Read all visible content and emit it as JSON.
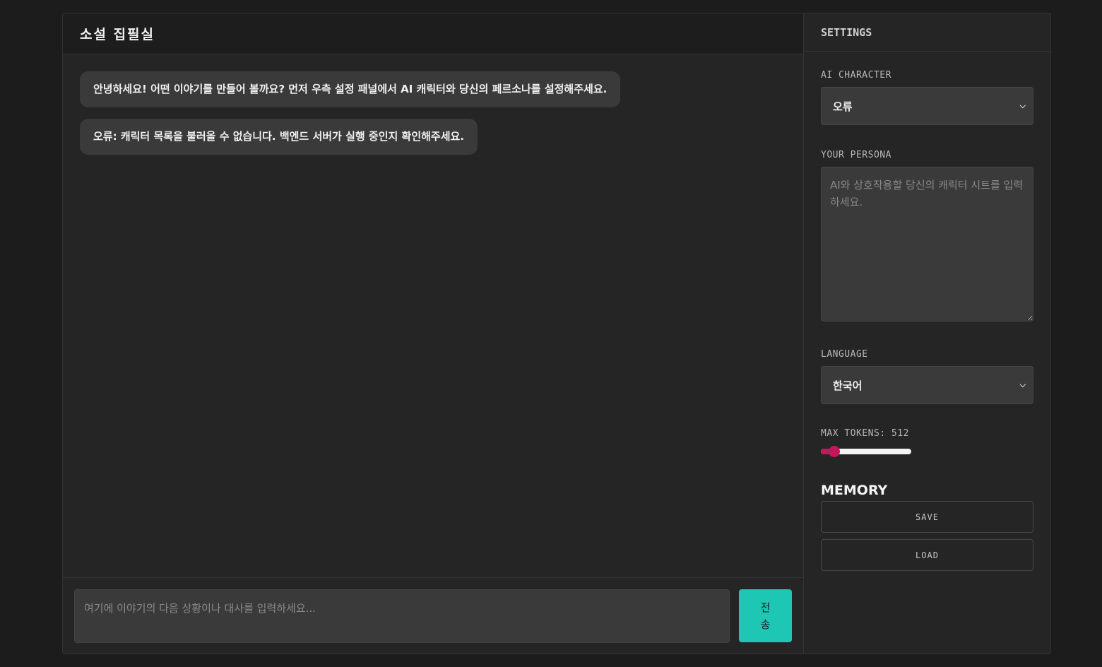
{
  "chat": {
    "title": "소설 집필실",
    "messages": [
      "안녕하세요! 어떤 이야기를 만들어 볼까요? 먼저 우측 설정 패널에서 AI 캐릭터와 당신의 페르소나를 설정해주세요.",
      "오류: 캐릭터 목록을 불러올 수 없습니다. 백엔드 서버가 실행 중인지 확인해주세요."
    ],
    "input_placeholder": "여기에 이야기의 다음 상황이나 대사를 입력하세요...",
    "send_label": "전송"
  },
  "settings": {
    "title": "SETTINGS",
    "ai_character": {
      "label": "AI CHARACTER",
      "value": "오류"
    },
    "persona": {
      "label": "YOUR PERSONA",
      "placeholder": "AI와 상호작용할 당신의 캐릭터 시트를 입력하세요."
    },
    "language": {
      "label": "LANGUAGE",
      "value": "한국어"
    },
    "max_tokens": {
      "label": "MAX TOKENS: 512",
      "value": 512,
      "fraction": 0.15
    },
    "memory": {
      "title": "MEMORY",
      "save_label": "SAVE",
      "load_label": "LOAD"
    }
  },
  "colors": {
    "accent_send": "#1ec7b4",
    "slider_accent": "#c2185b"
  }
}
